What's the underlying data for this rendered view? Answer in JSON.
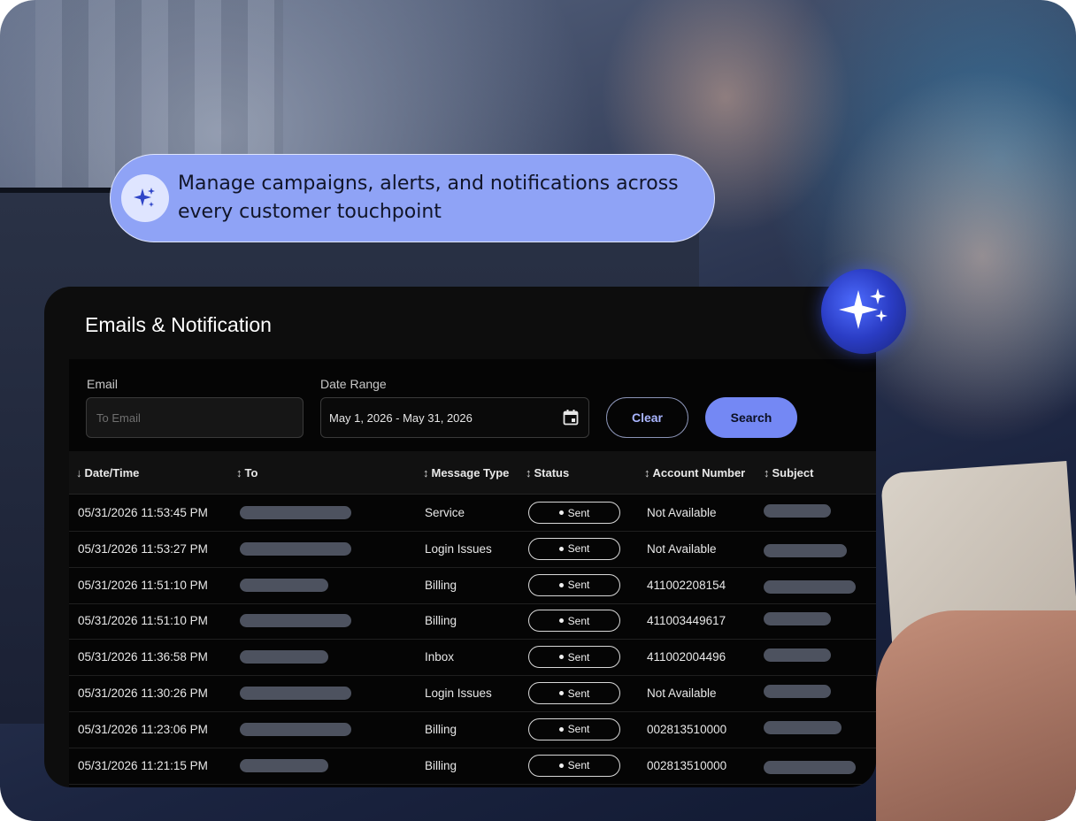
{
  "banner": {
    "text": "Manage campaigns, alerts, and notifications across every customer touchpoint",
    "icon": "sparkle-icon",
    "bg_color": "#8fa3f6"
  },
  "panel": {
    "title": "Emails & Notification"
  },
  "filters": {
    "email_label": "Email",
    "email_placeholder": "To Email",
    "email_value": "",
    "date_label": "Date Range",
    "date_value": "May 1, 2026 - May 31, 2026",
    "calendar_icon": "calendar-icon",
    "clear_label": "Clear",
    "search_label": "Search",
    "accent_color": "#7488f4"
  },
  "table": {
    "columns": [
      {
        "label": "Date/Time",
        "sort": "descending"
      },
      {
        "label": "To",
        "sort": "none"
      },
      {
        "label": "Message Type",
        "sort": "none"
      },
      {
        "label": "Status",
        "sort": "none"
      },
      {
        "label": "Account Number",
        "sort": "none"
      },
      {
        "label": "Subject",
        "sort": "none"
      }
    ],
    "rows": [
      {
        "datetime": "05/31/2026 11:53:45 PM",
        "message_type": "Service",
        "status": "Sent",
        "account_number": "Not Available"
      },
      {
        "datetime": "05/31/2026 11:53:27 PM",
        "message_type": "Login Issues",
        "status": "Sent",
        "account_number": "Not Available"
      },
      {
        "datetime": "05/31/2026 11:51:10 PM",
        "message_type": "Billing",
        "status": "Sent",
        "account_number": "411002208154"
      },
      {
        "datetime": "05/31/2026 11:51:10 PM",
        "message_type": "Billing",
        "status": "Sent",
        "account_number": "411003449617"
      },
      {
        "datetime": "05/31/2026 11:36:58 PM",
        "message_type": "Inbox",
        "status": "Sent",
        "account_number": "411002004496"
      },
      {
        "datetime": "05/31/2026 11:30:26 PM",
        "message_type": "Login Issues",
        "status": "Sent",
        "account_number": "Not Available"
      },
      {
        "datetime": "05/31/2026 11:23:06 PM",
        "message_type": "Billing",
        "status": "Sent",
        "account_number": "002813510000"
      },
      {
        "datetime": "05/31/2026 11:21:15 PM",
        "message_type": "Billing",
        "status": "Sent",
        "account_number": "002813510000"
      }
    ]
  }
}
